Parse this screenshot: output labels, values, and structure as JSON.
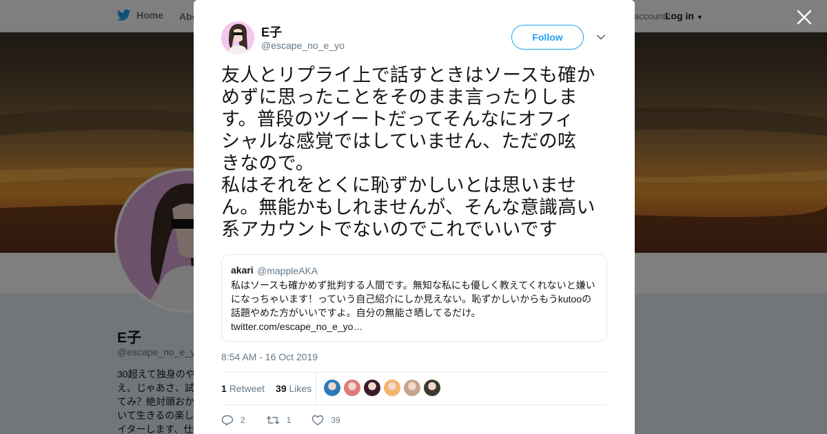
{
  "background": {
    "nav": {
      "home_label": "Home",
      "about_label": "Abo",
      "account_prompt": "account?",
      "login_label": "Log in"
    },
    "profile": {
      "name": "E子",
      "handle": "@escape_no_e_y",
      "bio_lines": [
        "30超えて独身のや",
        "え、じゃあさ、試",
        "てみ？絶対頭おか",
        "いて生きるの楽し",
        "イターします、仕"
      ]
    }
  },
  "tweet": {
    "author_name": "E子",
    "author_handle": "@escape_no_e_yo",
    "follow_label": "Follow",
    "text_lines": [
      "友人とリプライ上で話すときはソースも確か",
      "めずに思ったことをそのまま言ったりしま",
      "す。普段のツイートだってそんなにオフィ",
      "シャルな感覚ではしていません、ただの呟",
      "きなので。",
      "私はそれをとくに恥ずかしいとは思いませ",
      "ん。無能かもしれませんが、そんな意識高い",
      "系アカウントでないのでこれでいいです"
    ],
    "quote": {
      "name": "akari",
      "handle": "@mappleAKA",
      "text_lines": [
        "私はソースも確かめず批判する人間です。無知な私にも優しく教えてくれないと嫌い",
        "になっちゃいます！っていう自己紹介にしか見えない。恥ずかしいからもうkutooの",
        "話題やめた方がいいですよ。自分の無能さ晒してるだけ。",
        "twitter.com/escape_no_e_yo…"
      ]
    },
    "timestamp": "8:54 AM - 16 Oct 2019",
    "stats": {
      "retweets": "1",
      "retweets_label": "Retweet",
      "likes": "39",
      "likes_label": "Likes"
    },
    "actions": {
      "replies": "2",
      "retweets": "1",
      "likes": "39"
    },
    "liker_colors": [
      "#2b7bb8",
      "#e07a7a",
      "#3a1a2a",
      "#f2b36b",
      "#c9a48c",
      "#3b3b2e"
    ]
  },
  "colors": {
    "accent": "#1da1f2",
    "secondary_text": "#657786",
    "overlay": "rgba(0,0,0,0.5)"
  },
  "icons": {
    "close": "close-icon",
    "twitter": "twitter-bird-icon",
    "reply": "reply-icon",
    "retweet": "retweet-icon",
    "like": "heart-icon",
    "caret": "chevron-down-icon"
  }
}
